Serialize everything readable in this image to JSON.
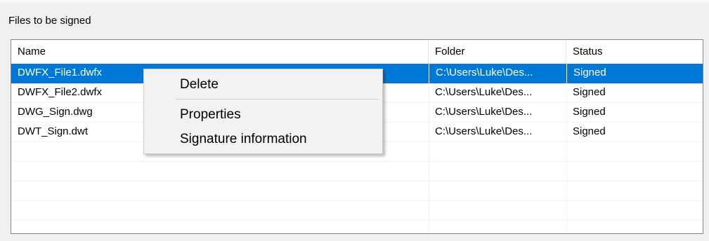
{
  "group": {
    "label": "Files to be signed"
  },
  "table": {
    "columns": [
      "Name",
      "Folder",
      "Status"
    ],
    "rows": [
      {
        "name": "DWFX_File1.dwfx",
        "folder": "C:\\Users\\Luke\\Des...",
        "status": "Signed",
        "selected": true
      },
      {
        "name": "DWFX_File2.dwfx",
        "folder": "C:\\Users\\Luke\\Des...",
        "status": "Signed",
        "selected": false
      },
      {
        "name": "DWG_Sign.dwg",
        "folder": "C:\\Users\\Luke\\Des...",
        "status": "Signed",
        "selected": false
      },
      {
        "name": "DWT_Sign.dwt",
        "folder": "C:\\Users\\Luke\\Des...",
        "status": "Signed",
        "selected": false
      }
    ],
    "selection_color": "#0078d7"
  },
  "context_menu": {
    "items": [
      {
        "label": "Delete"
      },
      {
        "label": "Properties"
      },
      {
        "label": "Signature information"
      }
    ]
  }
}
